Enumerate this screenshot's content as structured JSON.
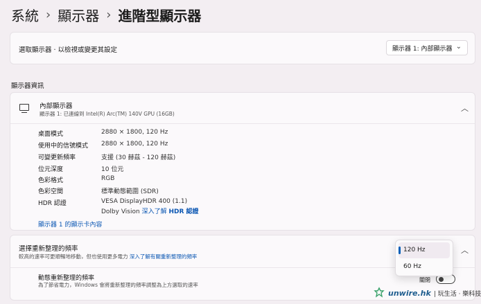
{
  "breadcrumb": {
    "root": "系統",
    "mid": "顯示器",
    "current": "進階型顯示器"
  },
  "select_display": {
    "label": "選取顯示器 · 以檢視或變更其設定",
    "value": "顯示器 1: 內部顯示器"
  },
  "section_title": "顯示器資訊",
  "display_info": {
    "title": "內部顯示器",
    "subtitle": "顯示器 1: 已連線到 Intel(R) Arc(TM) 140V GPU (16GB)",
    "rows": [
      {
        "key": "桌面模式",
        "value": "2880 × 1800, 120 Hz"
      },
      {
        "key": "使用中的信號模式",
        "value": "2880 × 1800, 120 Hz"
      },
      {
        "key": "可變更新頻率",
        "value": "支援 (30 赫茲 - 120 赫茲)"
      },
      {
        "key": "位元深度",
        "value": "10 位元"
      },
      {
        "key": "色彩格式",
        "value": "RGB"
      },
      {
        "key": "色彩空間",
        "value": "標準動態範圍 (SDR)"
      },
      {
        "key": "HDR 認證",
        "value": "VESA DisplayHDR 400 (1.1)"
      }
    ],
    "hdr_line2_prefix": "Dolby Vision",
    "hdr_link_text": "深入了解",
    "hdr_link_bold": "HDR 認證",
    "adapter_link": "顯示器 1 的顯示卡內容"
  },
  "refresh": {
    "title": "選擇重新整理的頻率",
    "desc": "較高的速率可更順暢地移動，但也使用更多電力",
    "desc_link": "深入了解有關重新整理的頻率",
    "dynamic_title": "動態重新整理的頻率",
    "dynamic_desc": "為了節省電力，Windows 會將重新整理的頻率調整為上方選取的速率",
    "toggle_label": "關閉",
    "toggle_on": false,
    "options": [
      "120 Hz",
      "60 Hz"
    ],
    "selected": "120 Hz"
  },
  "watermark": {
    "brand": "unwire.hk",
    "tag": "| 玩生活 · 樂科技"
  },
  "colors": {
    "accent": "#005fb8",
    "link": "#0b57b3",
    "background": "#f3eef2",
    "card": "#fbf9fb"
  }
}
